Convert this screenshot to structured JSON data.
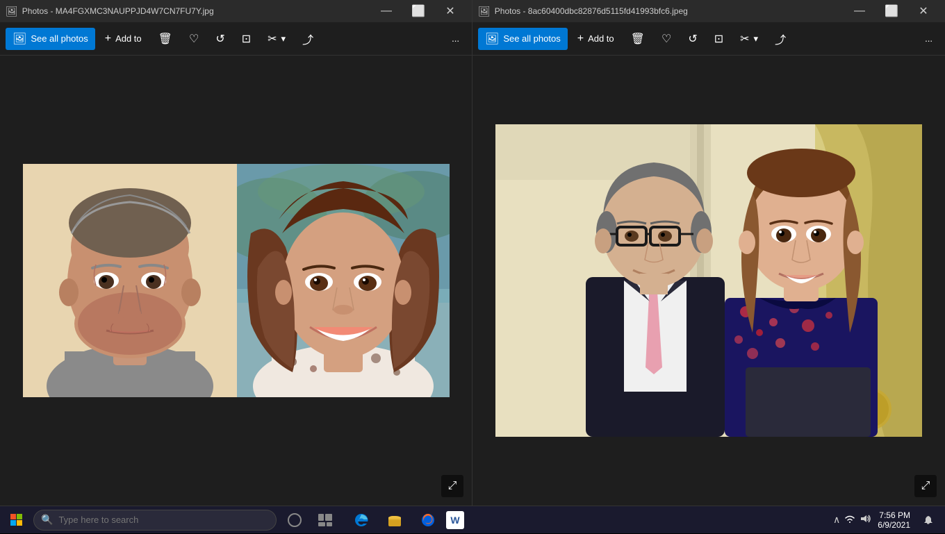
{
  "window_left": {
    "title": "Photos - MA4FGXMC3NAUPPJD4W7CN7FU7Y.jpg",
    "icon": "🖼",
    "controls": [
      "—",
      "⬜",
      "✕"
    ],
    "toolbar": {
      "see_all_photos": "See all photos",
      "add_to": "Add to",
      "delete_label": "",
      "favorite_label": "",
      "rotate_label": "",
      "crop_label": "",
      "edit_label": "",
      "share_label": "",
      "more_label": "..."
    }
  },
  "window_right": {
    "title": "Photos - 8ac60400dbc82876d5115fd41993bfc6.jpeg",
    "icon": "🖼",
    "controls": [
      "—",
      "⬜",
      "✕"
    ],
    "toolbar": {
      "see_all_photos": "See all photos",
      "add_to": "Add to",
      "delete_label": "",
      "favorite_label": "",
      "rotate_label": "",
      "crop_label": "",
      "edit_label": "",
      "share_label": "",
      "more_label": "..."
    }
  },
  "taskbar": {
    "start_icon": "⊞",
    "search_placeholder": "Type here to search",
    "search_icon": "🔍",
    "cortana_icon": "◯",
    "task_view_icon": "⧉",
    "apps": [
      {
        "name": "edge",
        "icon": "🌐",
        "active": false
      },
      {
        "name": "explorer",
        "icon": "📁",
        "active": false
      },
      {
        "name": "firefox",
        "icon": "🦊",
        "active": false
      },
      {
        "name": "word",
        "icon": "W",
        "active": false
      }
    ],
    "tray": {
      "chevron": "∧",
      "network": "WiFi",
      "volume": "🔊",
      "battery": ""
    },
    "time": "7:56 PM",
    "date": "6/9/2021",
    "notification_icon": "💬"
  },
  "colors": {
    "accent": "#0078d4",
    "taskbar_bg": "#1a1a2e",
    "window_bg": "#1e1e1e",
    "toolbar_bg": "#2b2b2b",
    "title_bg": "#2b2b2b"
  }
}
